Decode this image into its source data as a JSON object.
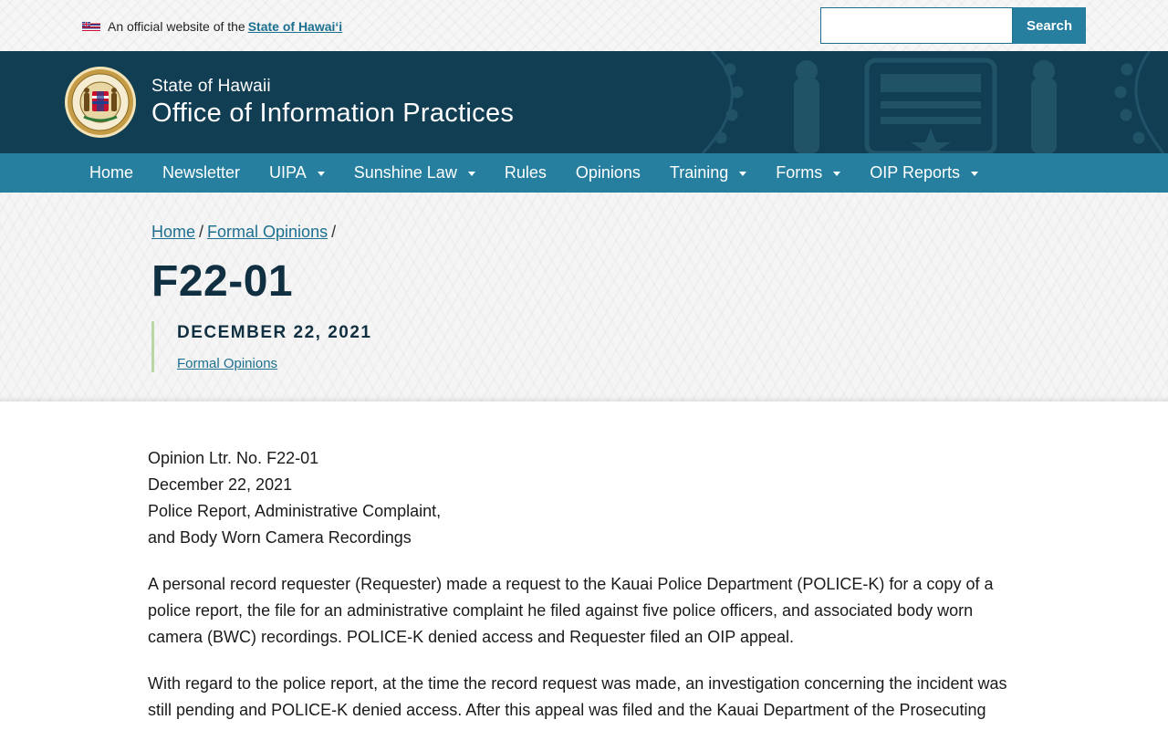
{
  "topbar": {
    "official_prefix": "An official website of the",
    "official_link": "State of Hawaiʻi",
    "search_placeholder": "",
    "search_button": "Search"
  },
  "banner": {
    "subtitle": "State of Hawaii",
    "title": "Office of Information Practices"
  },
  "nav": {
    "items": [
      {
        "label": "Home"
      },
      {
        "label": "Newsletter"
      },
      {
        "label": "UIPA"
      },
      {
        "label": "Sunshine Law"
      },
      {
        "label": "Rules"
      },
      {
        "label": "Opinions"
      },
      {
        "label": "Training"
      },
      {
        "label": "Forms"
      },
      {
        "label": "OIP Reports"
      }
    ]
  },
  "page": {
    "breadcrumb": [
      {
        "label": "Home"
      },
      {
        "label": "Formal Opinions"
      }
    ],
    "breadcrumb_sep": "/",
    "title": "F22-01",
    "date": "DECEMBER 22, 2021",
    "category": "Formal Opinions"
  },
  "content": {
    "header_lines": [
      "Opinion Ltr. No. F22-01",
      "December 22, 2021",
      "Police Report, Administrative Complaint,",
      "and Body Worn Camera Recordings"
    ],
    "paragraphs": [
      "A personal record requester (Requester) made a request to the Kauai Police Department (POLICE-K) for a copy of a police report, the file for an administrative complaint he filed against five police officers, and associated body worn camera (BWC) recordings.  POLICE-K denied access and Requester filed an OIP appeal.",
      "With regard to the police report, at the time the record request was made, an investigation concerning the incident was still pending and POLICE-K denied access.  After this appeal was filed and the Kauai Department of the Prosecuting"
    ]
  },
  "colors": {
    "banner": "#123e54",
    "nav": "#267f9f",
    "link": "#1c6f8f",
    "title": "#102f40",
    "meta_rule": "#b8d6a6"
  }
}
